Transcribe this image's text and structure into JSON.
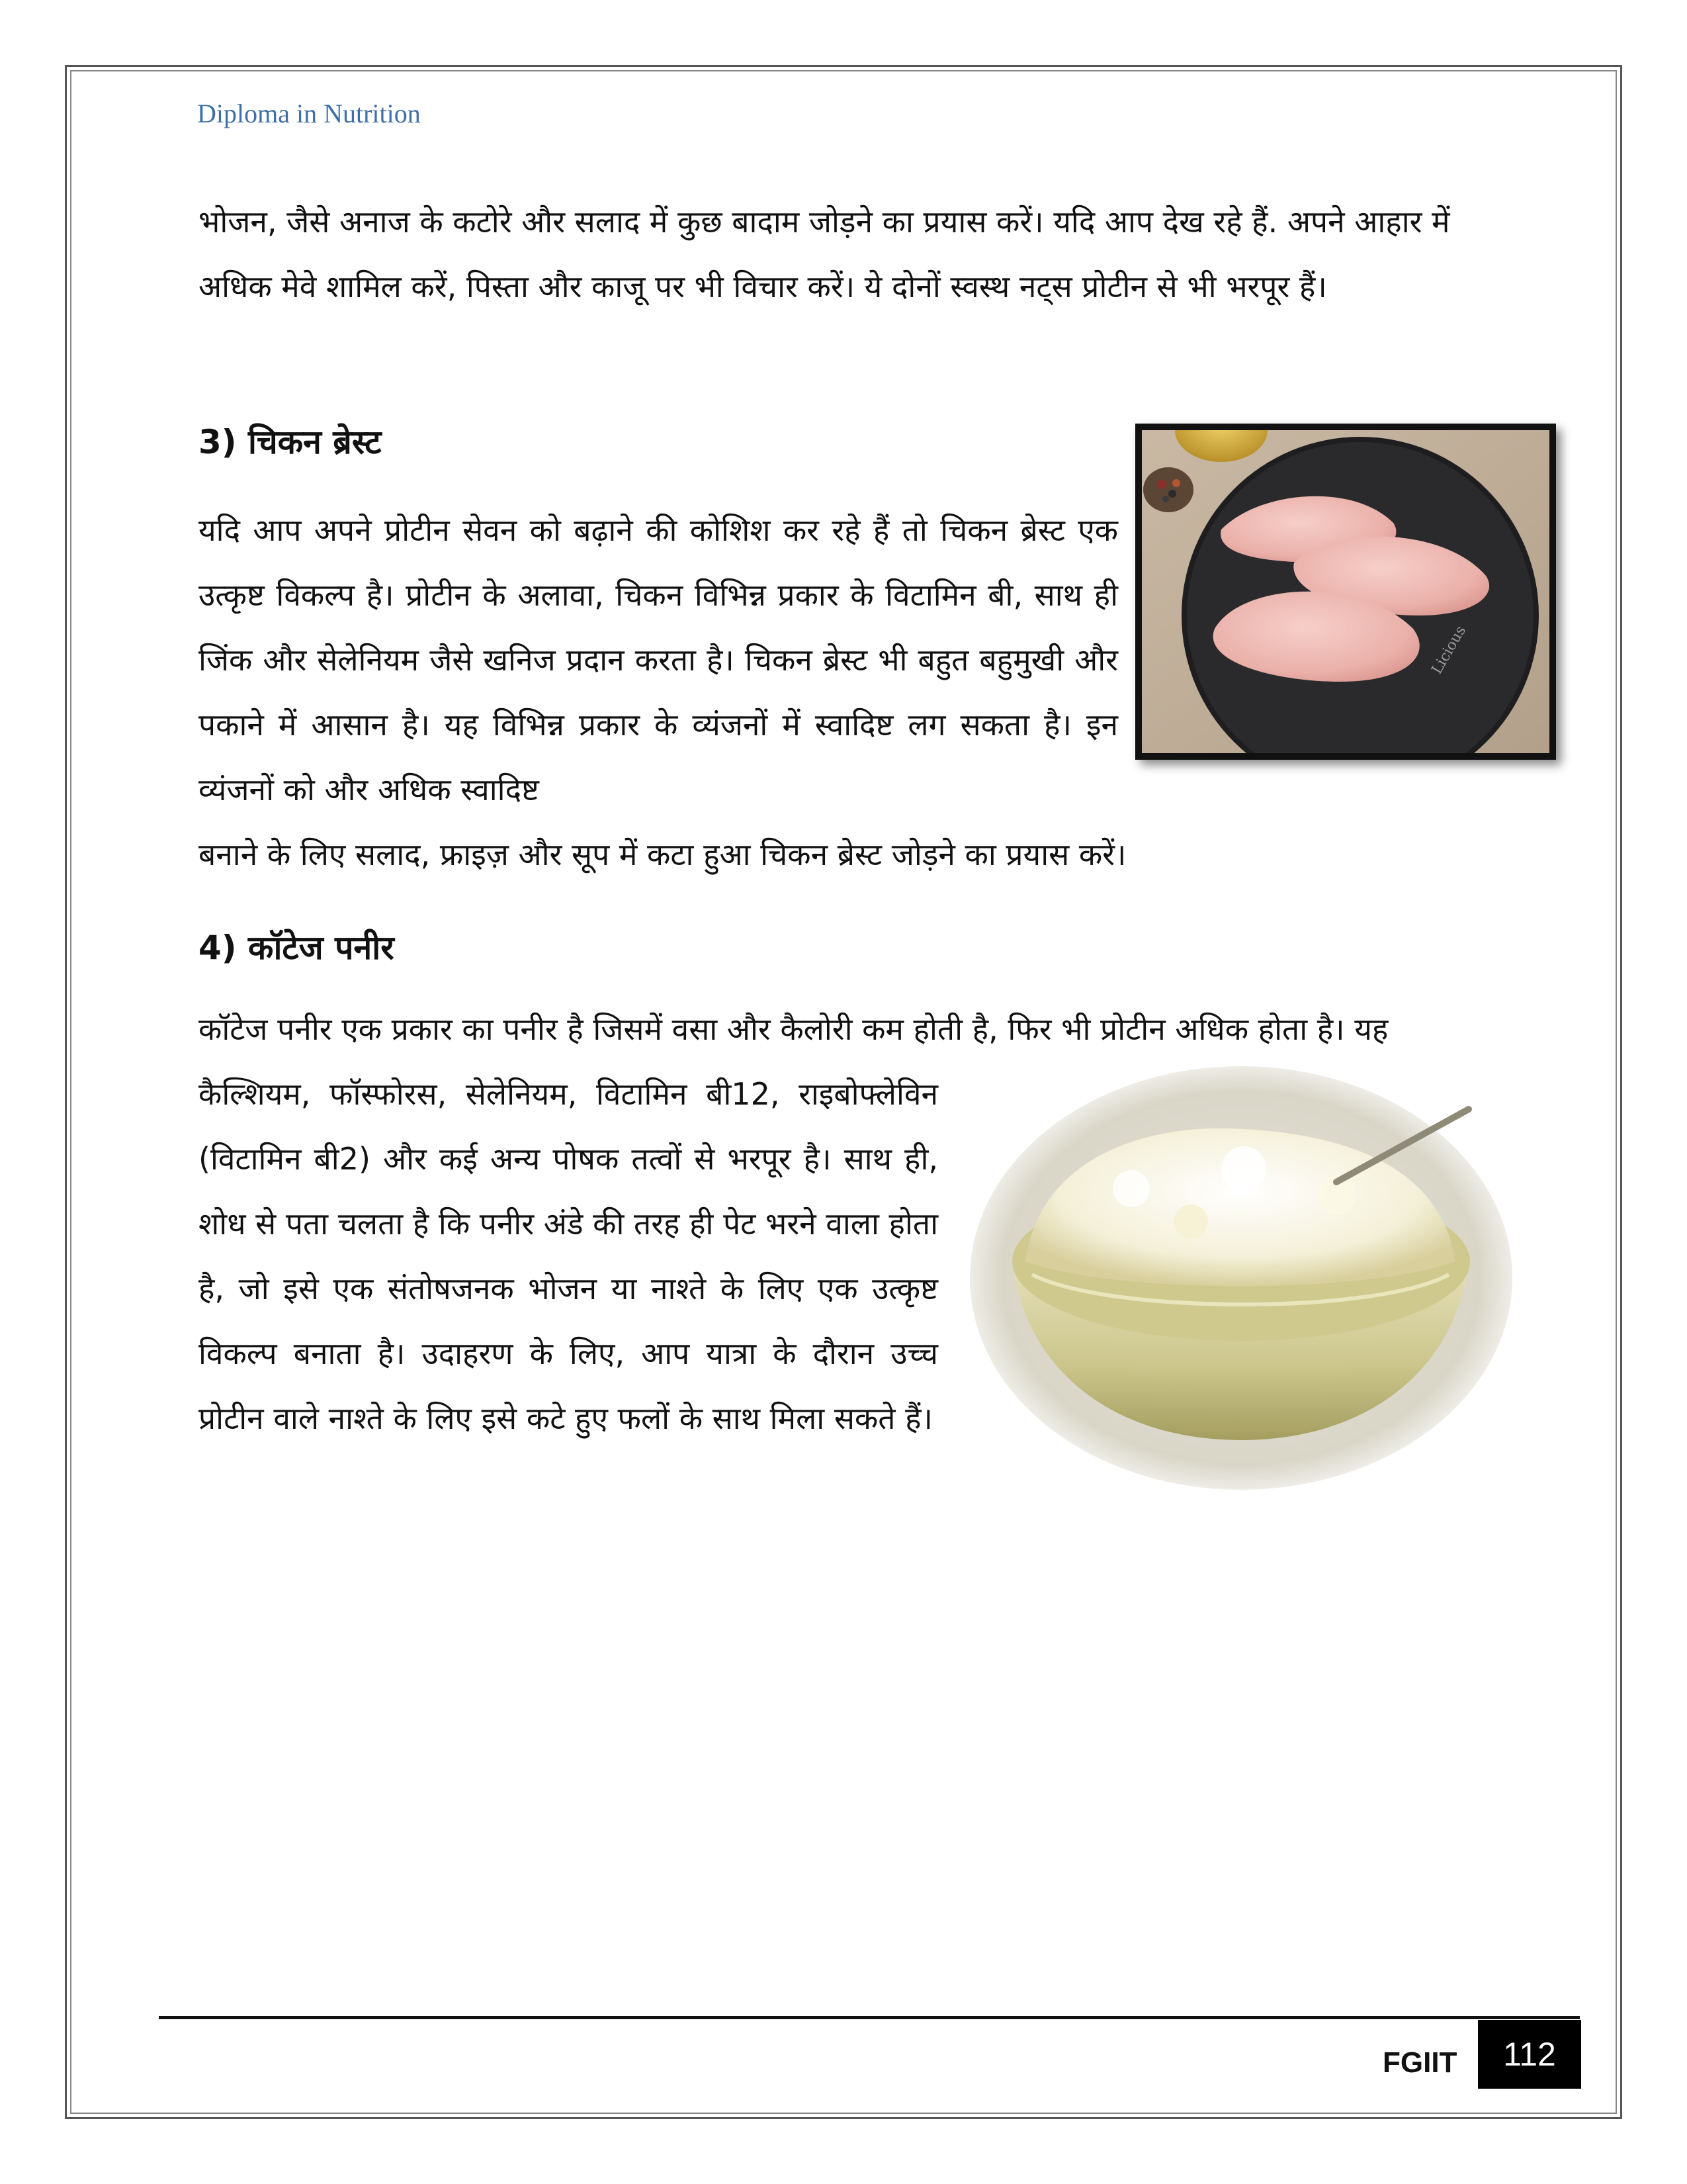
{
  "header": {
    "title": "Diploma in Nutrition"
  },
  "intro": {
    "text": "भोजन, जैसे अनाज के कटोरे और सलाद में कुछ बादाम जोड़ने का प्रयास करें। यदि आप देख रहे हैं. अपने आहार में अधिक मेवे शामिल करें, पिस्ता और काजू पर भी विचार करें। ये दोनों स्वस्थ नट्स प्रोटीन से भी भरपूर हैं।"
  },
  "sections": [
    {
      "heading": "3) चिकन ब्रेस्ट",
      "text_beside_image": "यदि आप अपने प्रोटीन सेवन को बढ़ाने की कोशिश कर रहे हैं तो चिकन ब्रेस्ट एक उत्कृष्ट विकल्प है। प्रोटीन के अलावा, चिकन विभिन्न प्रकार के विटामिन बी, साथ ही जिंक और सेलेनियम जैसे खनिज प्रदान करता है। चिकन ब्रेस्ट भी बहुत बहुमुखी और पकाने में आसान है। यह विभिन्न प्रकार के व्यंजनों में स्वादिष्ट लग सकता है। इन व्यंजनों को और अधिक स्वादिष्ट",
      "text_full_width": "बनाने के लिए सलाद, फ्राइज़ और सूप में कटा हुआ चिकन ब्रेस्ट जोड़ने का प्रयास करें।",
      "image": {
        "label": "Licious"
      }
    },
    {
      "heading": "4) कॉटेज पनीर",
      "text_full_width": "कॉटेज पनीर एक प्रकार का पनीर है जिसमें वसा और कैलोरी कम होती है, फिर भी प्रोटीन अधिक होता है। यह",
      "text_beside_image": "कैल्शियम, फॉस्फोरस, सेलेनियम, विटामिन बी12, राइबोफ्लेविन (विटामिन बी2) और कई अन्य पोषक तत्वों से भरपूर है। साथ ही, शोध से पता चलता है कि पनीर अंडे की तरह ही पेट भरने वाला होता है, जो इसे एक संतोषजनक भोजन या नाश्ते के लिए एक उत्कृष्ट विकल्प बनाता है। उदाहरण के लिए, आप यात्रा के दौरान उच्च प्रोटीन वाले नाश्ते के लिए इसे कटे हुए फलों के साथ मिला सकते हैं।"
    }
  ],
  "footer": {
    "org": "FGIIT",
    "page_number": "112"
  }
}
